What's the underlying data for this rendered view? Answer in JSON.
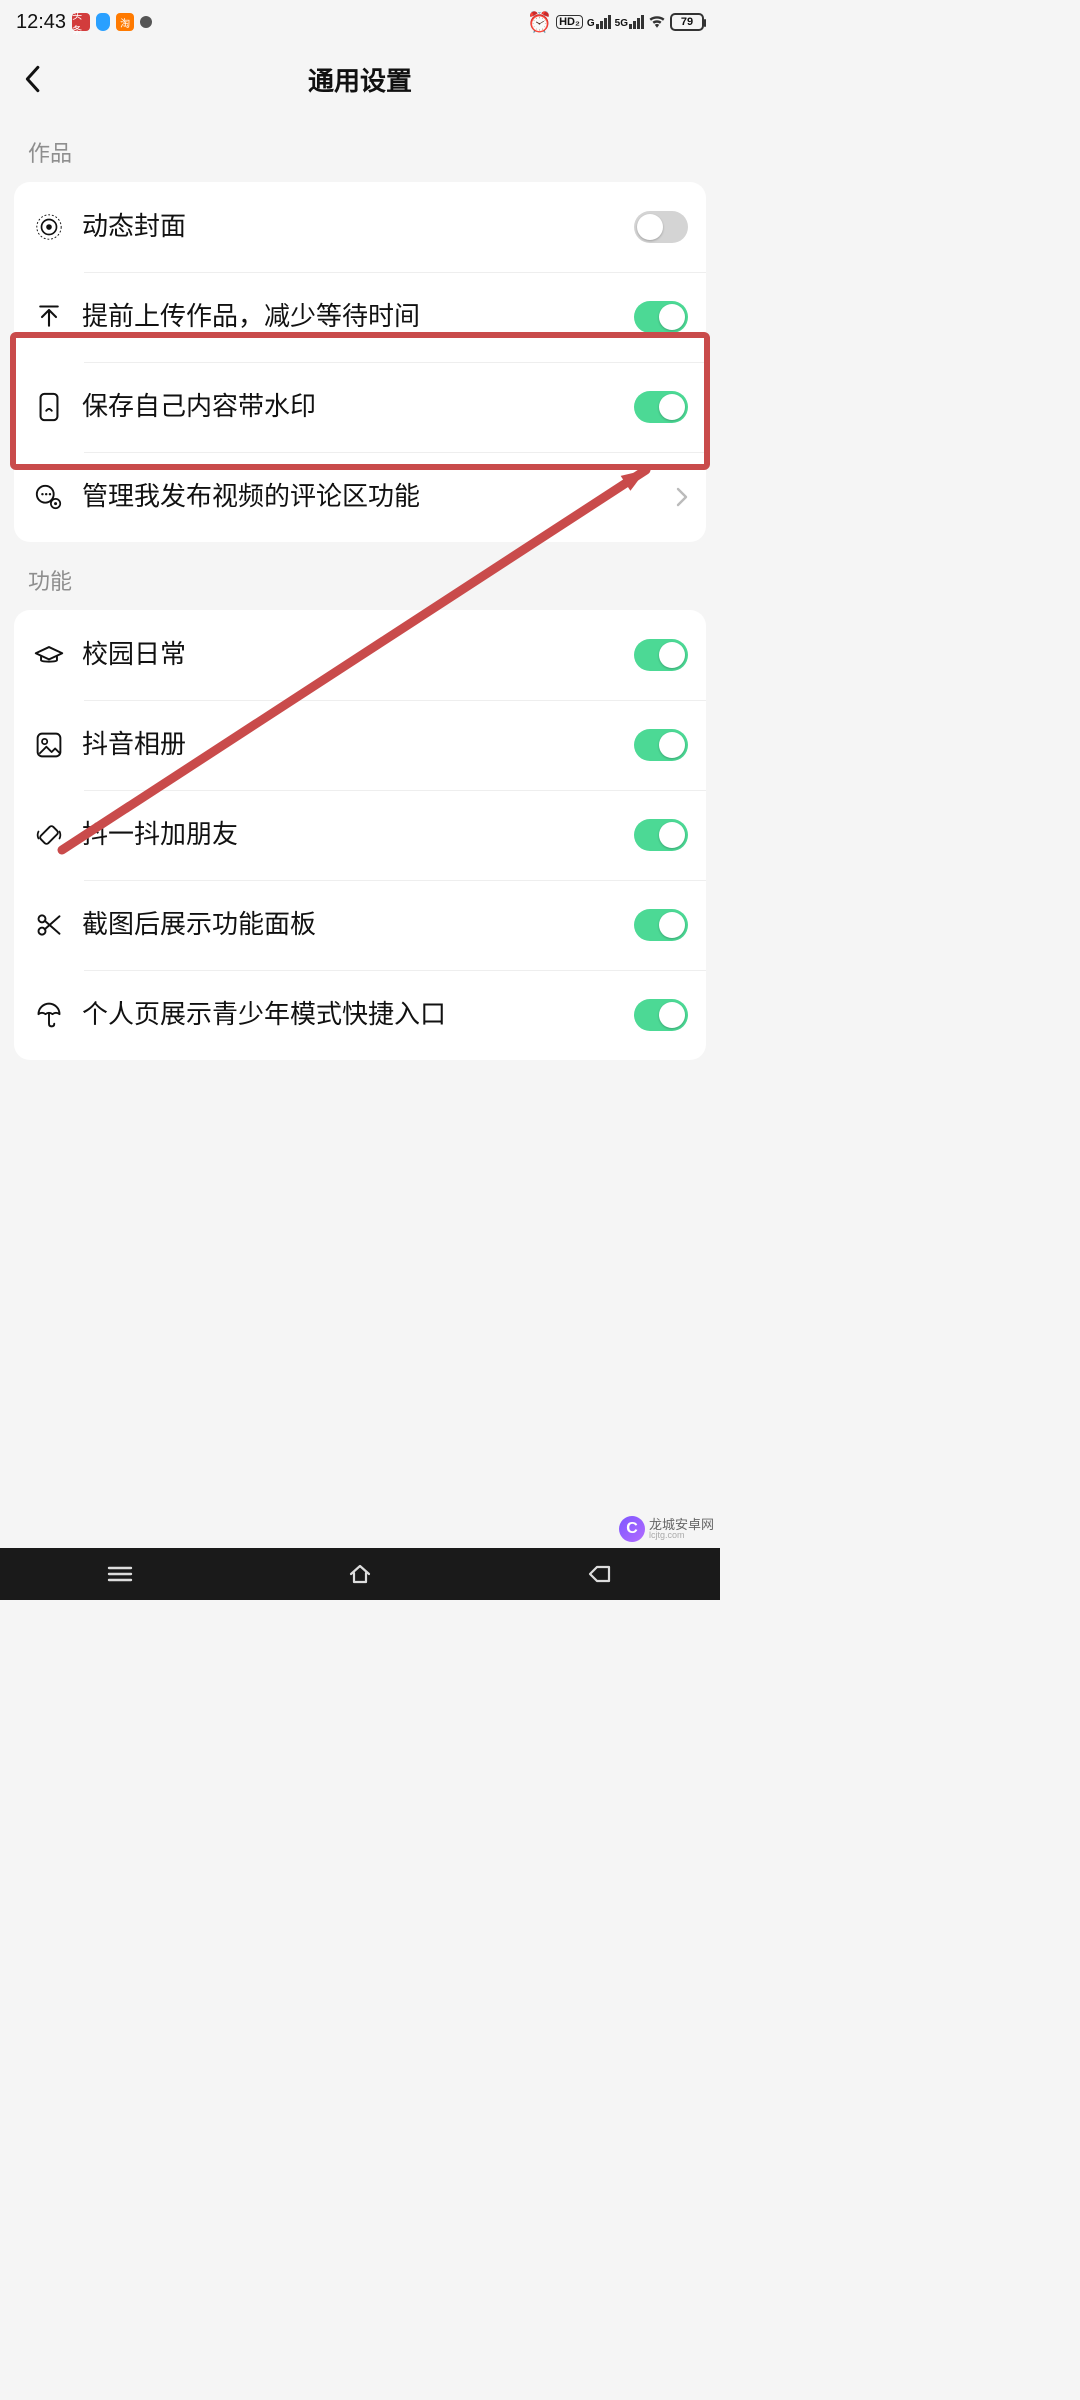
{
  "status": {
    "time": "12:43",
    "battery": "79",
    "net1_label": "G",
    "net2_label": "5G",
    "hd_label": "HD₂"
  },
  "header": {
    "title": "通用设置"
  },
  "sections": {
    "works": {
      "label": "作品",
      "items": [
        {
          "id": "dynamic-cover",
          "label": "动态封面",
          "toggle": false
        },
        {
          "id": "pre-upload",
          "label": "提前上传作品，减少等待时间",
          "toggle": true
        },
        {
          "id": "watermark",
          "label": "保存自己内容带水印",
          "toggle": true
        },
        {
          "id": "manage-comments",
          "label": "管理我发布视频的评论区功能",
          "nav": true
        }
      ]
    },
    "features": {
      "label": "功能",
      "items": [
        {
          "id": "campus",
          "label": "校园日常",
          "toggle": true
        },
        {
          "id": "album",
          "label": "抖音相册",
          "toggle": true
        },
        {
          "id": "shake",
          "label": "抖一抖加朋友",
          "toggle": true
        },
        {
          "id": "screenshot",
          "label": "截图后展示功能面板",
          "toggle": true
        },
        {
          "id": "teen-mode",
          "label": "个人页展示青少年模式快捷入口",
          "toggle": true
        }
      ]
    }
  },
  "annotation": {
    "highlight_target": "watermark",
    "color": "#c94b4b"
  },
  "watermark_logo": {
    "brand_char": "C",
    "line1": "龙城安卓网",
    "line2": "lcjtg.com"
  }
}
